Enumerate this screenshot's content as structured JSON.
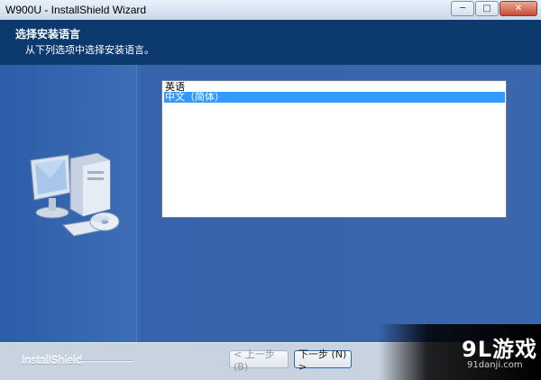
{
  "window": {
    "title": "W900U - InstallShield Wizard",
    "minimize_glyph": "─",
    "maximize_glyph": "□",
    "close_glyph": "✕"
  },
  "header": {
    "title": "选择安装语言",
    "subtitle": "从下列选项中选择安装语言。"
  },
  "language_list": {
    "items": [
      {
        "label": "英语",
        "selected": false
      },
      {
        "label": "中文（简体）",
        "selected": true
      }
    ]
  },
  "footer": {
    "brand": "InstallShield",
    "back_label": "< 上一步 (B)",
    "next_label": "下一步 (N) >"
  },
  "watermark": {
    "logo": "9L游戏",
    "url": "91danji.com"
  },
  "colors": {
    "header_bg": "#0c3a6f",
    "body_bg": "#3a66ad",
    "selection": "#3399ff"
  }
}
